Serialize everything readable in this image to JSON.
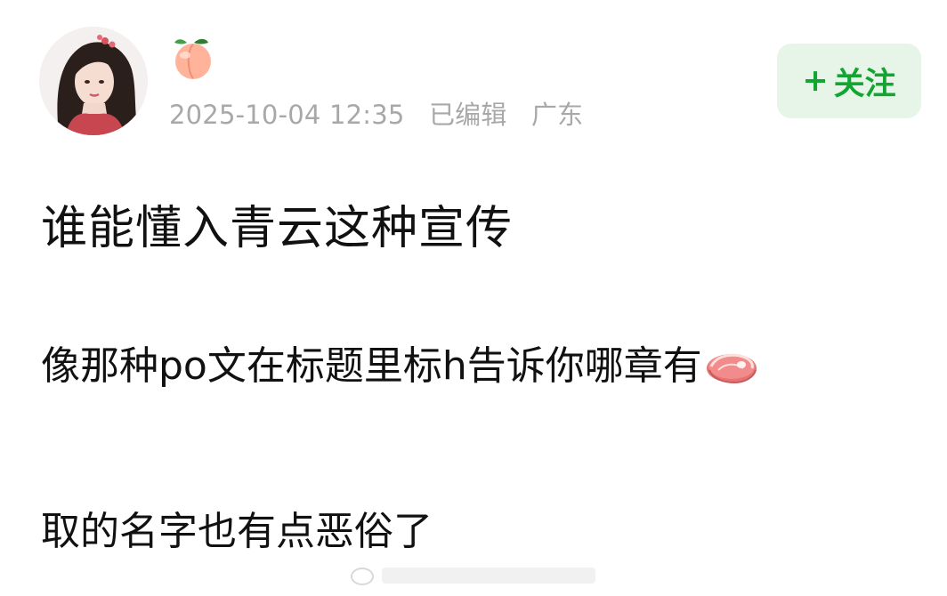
{
  "author": {
    "nickname_emoji": "peach-emoji",
    "avatar": "user-avatar"
  },
  "meta": {
    "date": "2025-10-04 12:35",
    "edited": "已编辑",
    "location": "广东"
  },
  "follow_button": {
    "plus": "+",
    "label": "关注"
  },
  "post": {
    "title": "谁能懂入青云这种宣传",
    "line1": "像那种po文在标题里标h告诉你哪章有",
    "line1_emoji": "meat-emoji",
    "line2": "取的名字也有点恶俗了"
  },
  "colors": {
    "accent": "#12a532",
    "accent_bg": "#e7f5e9",
    "meta_text": "#a8a8a8",
    "body_text": "#111111"
  }
}
